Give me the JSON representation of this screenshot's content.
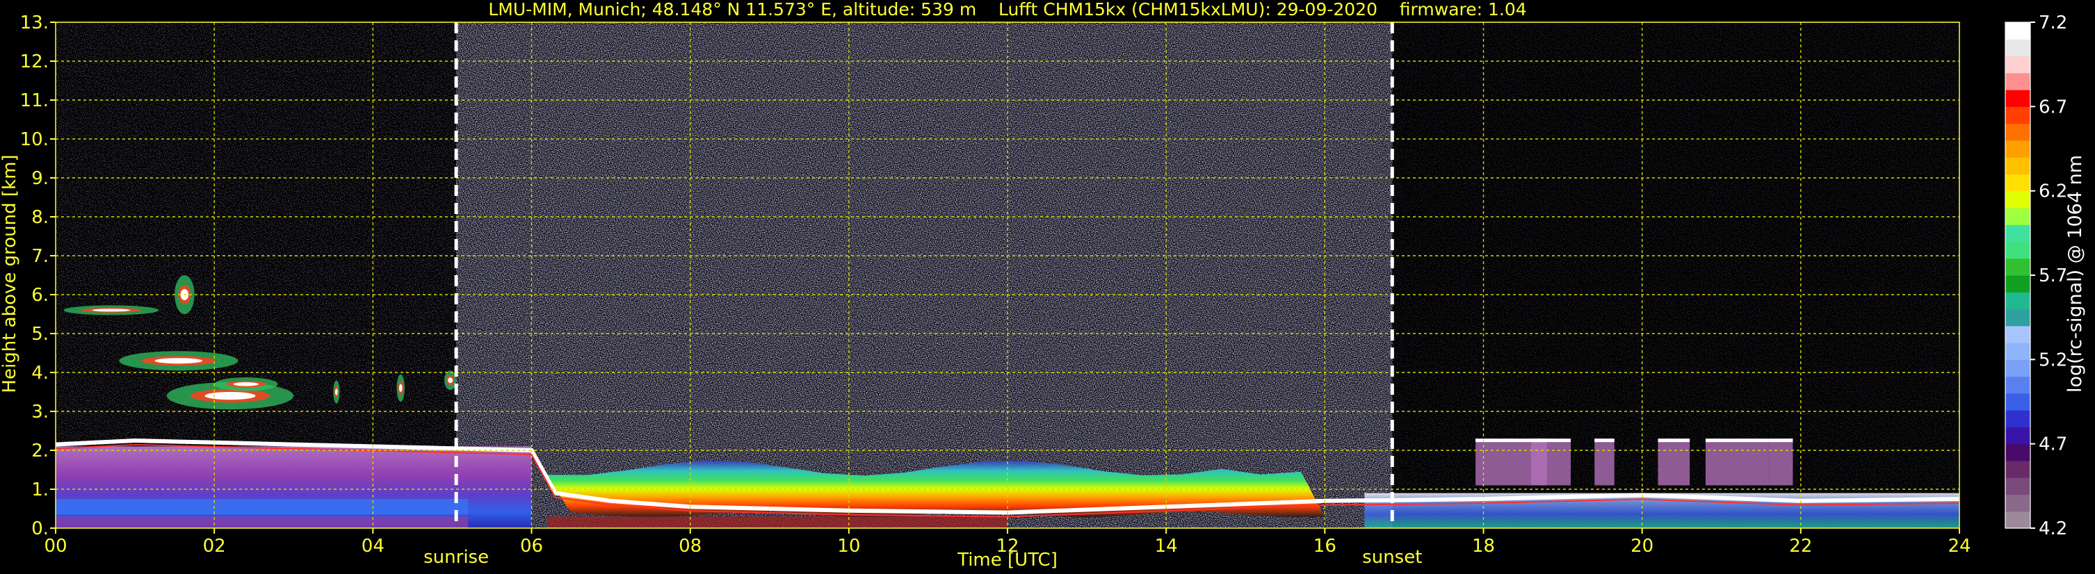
{
  "chart_data": {
    "type": "heatmap",
    "title": "LMU-MIM, Munich; 48.148° N 11.573° E, altitude: 539 m    Lufft CHM15kx (CHM15kxLMU): 29-09-2020    firmware: 1.04",
    "xlabel": "Time [UTC]",
    "ylabel": "Height above ground [km]",
    "xlim": [
      0,
      24
    ],
    "ylim": [
      0,
      13
    ],
    "x_ticks": [
      "00",
      "02",
      "04",
      "06",
      "08",
      "10",
      "12",
      "14",
      "16",
      "18",
      "20",
      "22",
      "24"
    ],
    "y_ticks": [
      "0.",
      "1.",
      "2.",
      "3.",
      "4.",
      "5.",
      "6.",
      "7.",
      "8.",
      "9.",
      "10.",
      "11.",
      "12.",
      "13."
    ],
    "grid": true,
    "annotations": [
      {
        "label": "sunrise",
        "x": 5.05
      },
      {
        "label": "sunset",
        "x": 16.85
      }
    ],
    "colorbar": {
      "label": "log(rc-signal) @ 1064 nm",
      "range": [
        4.2,
        7.2
      ],
      "ticks": [
        "4.2",
        "4.7",
        "5.2",
        "5.7",
        "6.2",
        "6.7",
        "7.2"
      ],
      "colors": [
        "#9a8a9a",
        "#8a6a8a",
        "#7a4a7a",
        "#6a2a6a",
        "#4a0a6a",
        "#3a14a8",
        "#3030d0",
        "#3a60e8",
        "#5a80f0",
        "#7aa0f8",
        "#90b4fc",
        "#a8c4ff",
        "#30a0a0",
        "#20b890",
        "#10a020",
        "#30c030",
        "#40e080",
        "#40e0a0",
        "#a0ff40",
        "#e0ff00",
        "#ffe000",
        "#ffc000",
        "#ffa000",
        "#ff7000",
        "#ff4000",
        "#ff0000",
        "#ff9090",
        "#ffd0d0",
        "#e8e8e8",
        "#ffffff"
      ]
    },
    "layers": [
      {
        "name": "boundary",
        "points": [
          [
            0,
            2.15
          ],
          [
            0.5,
            2.2
          ],
          [
            1,
            2.25
          ],
          [
            2,
            2.2
          ],
          [
            3,
            2.15
          ],
          [
            4,
            2.1
          ],
          [
            5,
            2.05
          ],
          [
            6,
            2.0
          ],
          [
            6.3,
            0.9
          ],
          [
            7,
            0.7
          ],
          [
            8,
            0.55
          ],
          [
            10,
            0.45
          ],
          [
            12,
            0.4
          ],
          [
            14,
            0.55
          ],
          [
            16,
            0.7
          ],
          [
            17,
            0.72
          ],
          [
            18,
            0.75
          ],
          [
            20,
            0.85
          ],
          [
            22,
            0.7
          ],
          [
            24,
            0.75
          ]
        ]
      },
      {
        "name": "residual-band",
        "x": [
          0,
          6
        ],
        "y": [
          0,
          2.1
        ]
      },
      {
        "name": "aerosol-layer",
        "x": [
          6,
          16
        ],
        "y": [
          0.4,
          1.8
        ]
      },
      {
        "name": "elevated-clouds",
        "x": [
          0,
          5
        ],
        "y": [
          2.8,
          7.0
        ]
      },
      {
        "name": "low-clouds",
        "x": [
          17.8,
          21.8
        ],
        "y": [
          1.1,
          2.3
        ]
      }
    ]
  }
}
